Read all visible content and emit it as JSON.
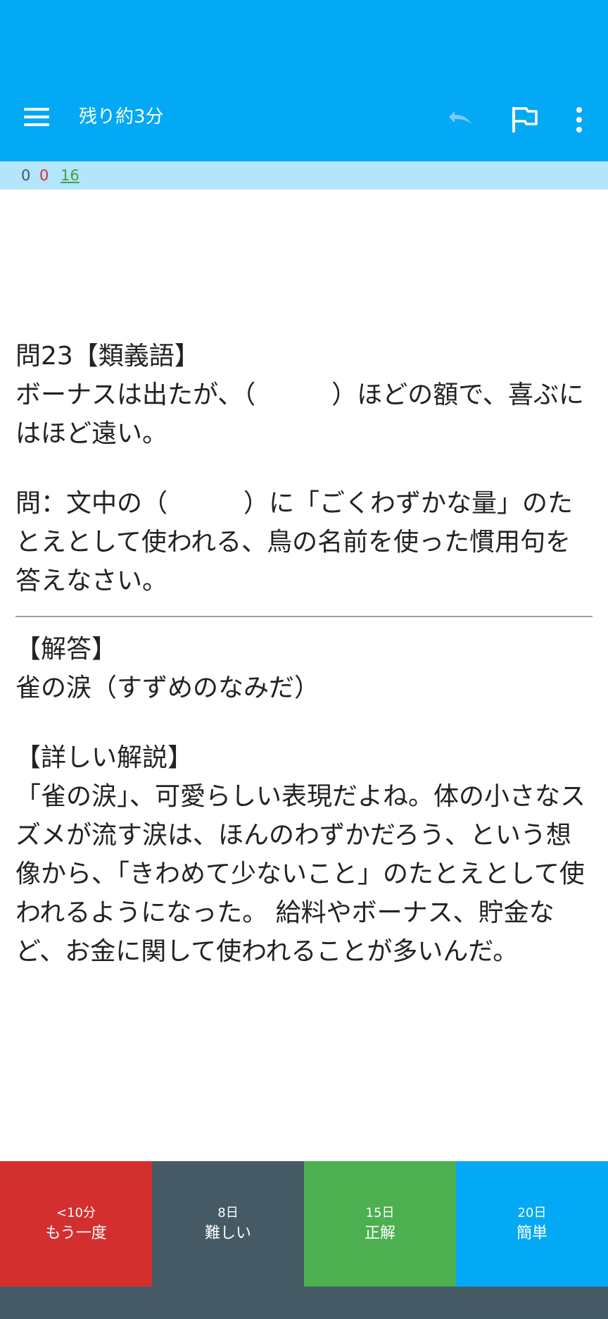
{
  "toolbar": {
    "title": "残り約3分",
    "menu_icon": "hamburger-menu-icon",
    "undo_icon": "undo-icon",
    "flag_icon": "flag-icon",
    "more_icon": "more-vertical-icon"
  },
  "counts": {
    "new": "0",
    "learning": "0",
    "review": "16"
  },
  "card": {
    "question_heading": "問23【類義語】",
    "question_sentence": "ボーナスは出たが、（　　　）ほどの額で、喜ぶにはほど遠い。",
    "question_prompt": "問：文中の（　　　）に「ごくわずかな量」のたとえとして使われる、鳥の名前を使った慣用句を答えなさい。",
    "answer_heading": "【解答】",
    "answer_text": "雀の涙（すずめのなみだ）",
    "explanation_heading": "【詳しい解説】",
    "explanation_text": "「雀の涙」、可愛らしい表現だよね。体の小さなスズメが流す涙は、ほんのわずかだろう、という想像から、「きわめて少ないこと」のたとえとして使われるようになった。 給料やボーナス、貯金など、お金に関して使われることが多いんだ。"
  },
  "answer_buttons": [
    {
      "interval": "<10分",
      "label": "もう一度"
    },
    {
      "interval": "8日",
      "label": "難しい"
    },
    {
      "interval": "15日",
      "label": "正解"
    },
    {
      "interval": "20日",
      "label": "簡単"
    }
  ],
  "colors": {
    "toolbar": "#03A9F4",
    "counts_bar": "#B3E5FC",
    "again": "#D32F2F",
    "hard": "#455A64",
    "good": "#4CAF50",
    "easy": "#03A9F4"
  }
}
